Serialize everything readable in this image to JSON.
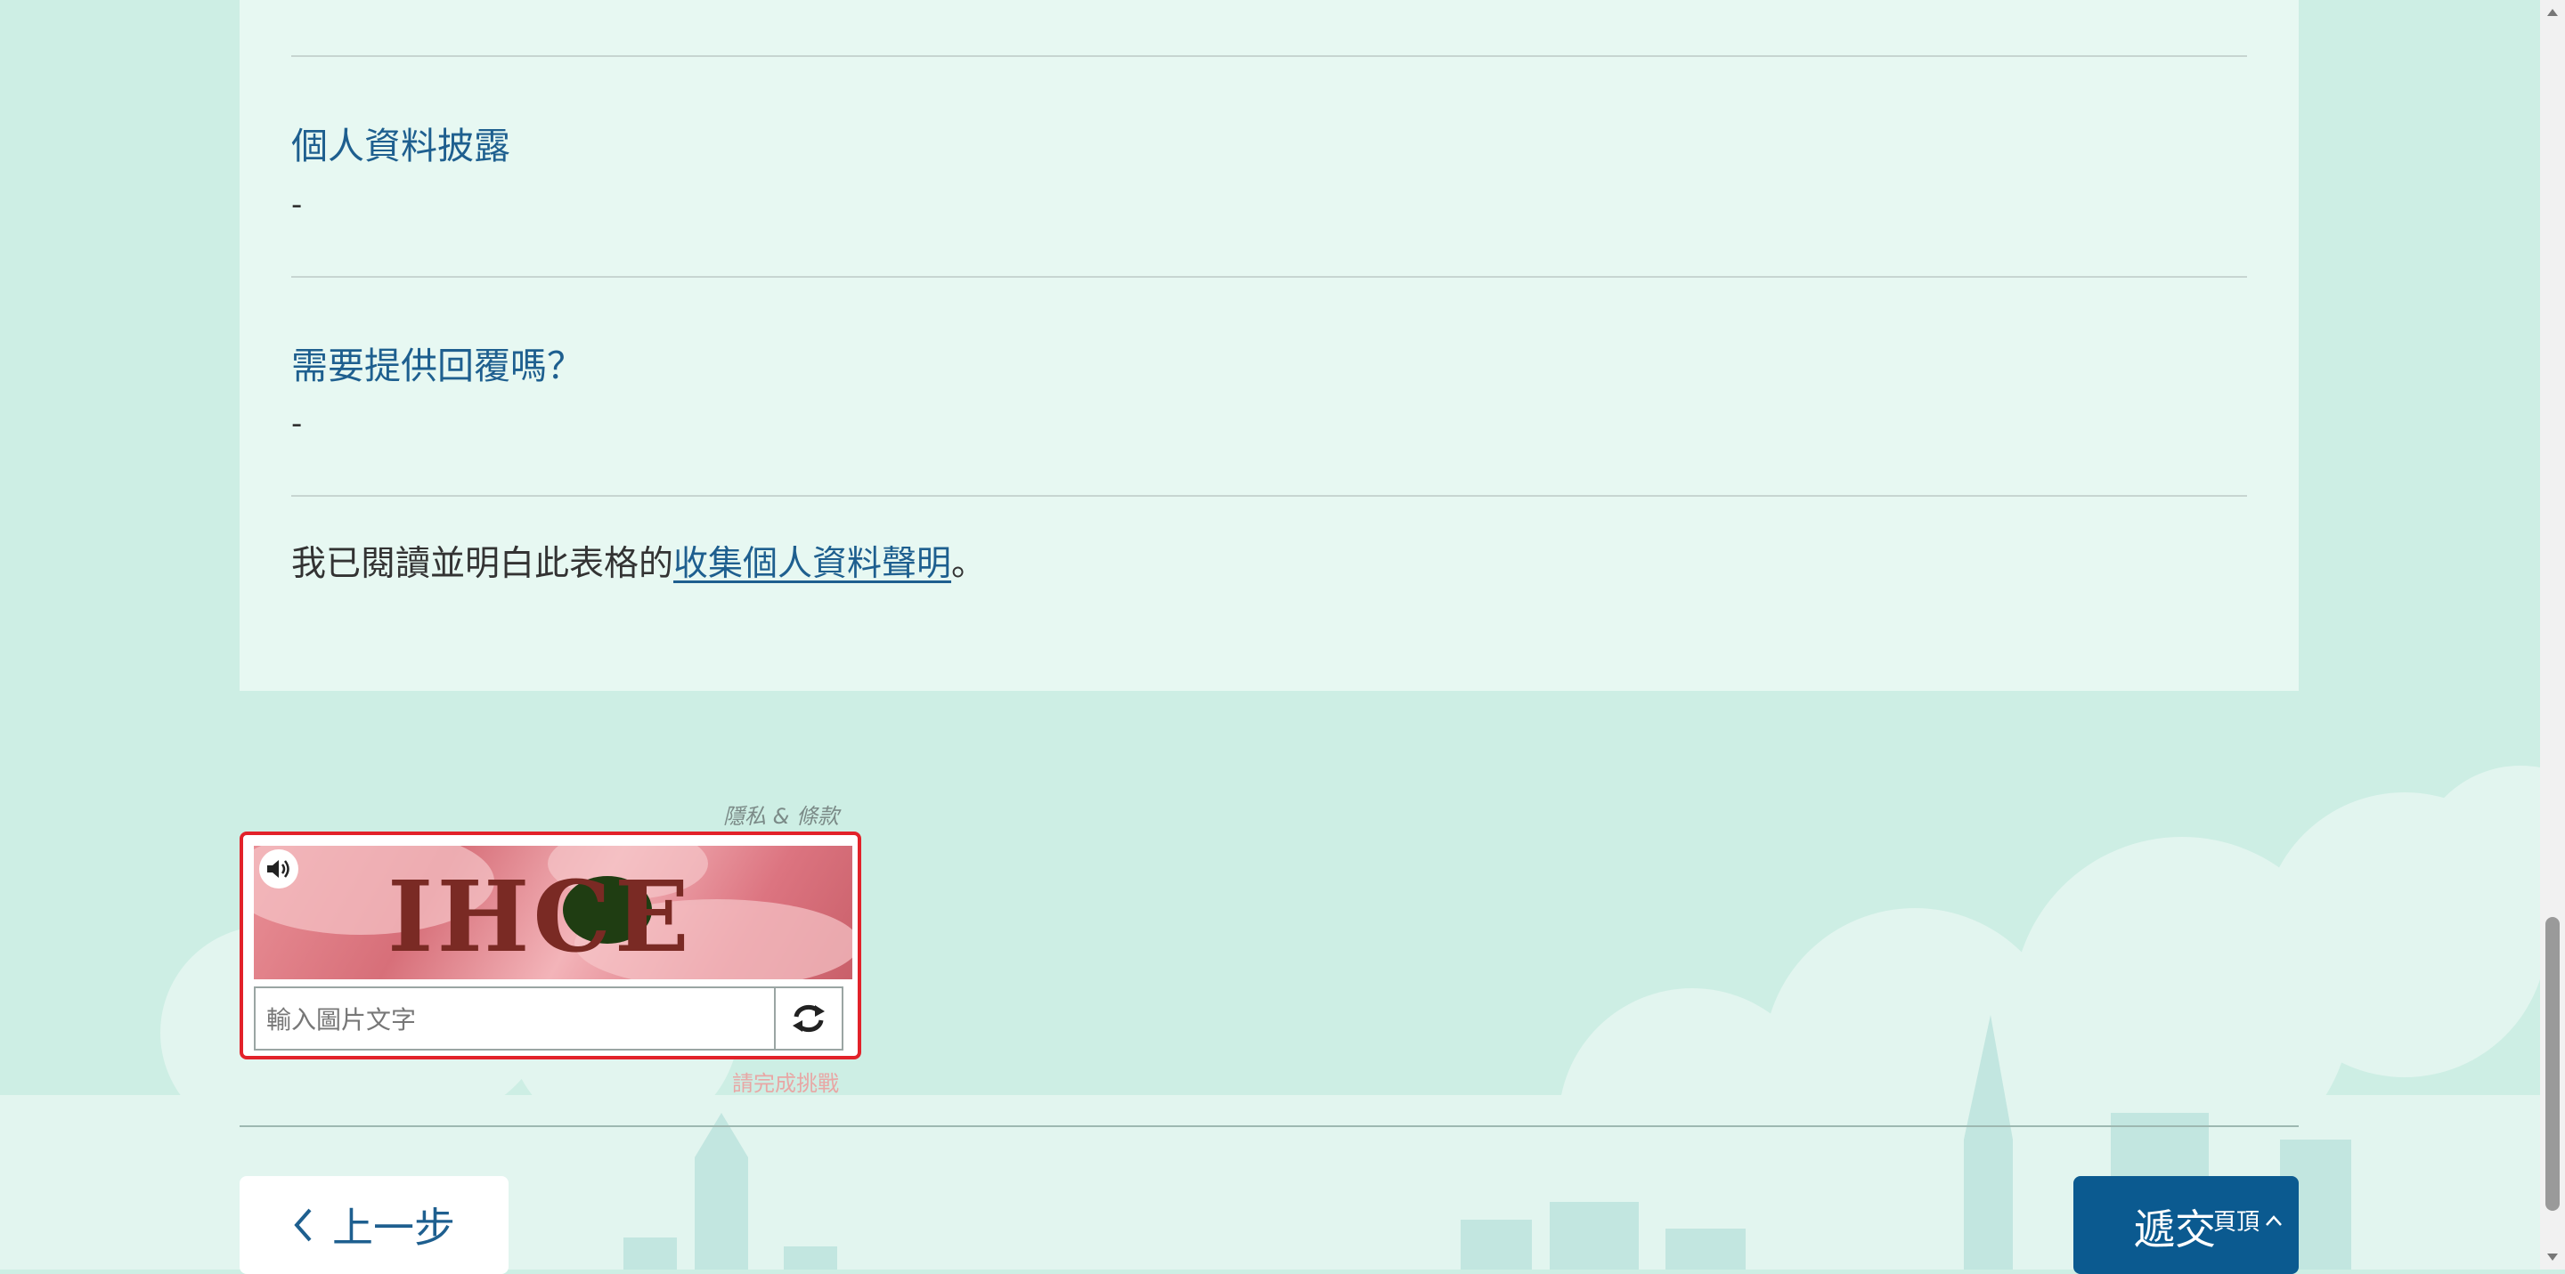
{
  "form": {
    "section1": {
      "title": "個人資料披露",
      "value": "-"
    },
    "section2": {
      "title": "需要提供回覆嗎？",
      "value": "-"
    },
    "declaration": {
      "prefix": "我已閱讀並明白此表格的",
      "link": "收集個人資料聲明",
      "suffix": "。"
    }
  },
  "captcha": {
    "privacy_link": "隱私 & 條款",
    "image_text": "IHCE",
    "input_placeholder": "輸入圖片文字",
    "error": "請完成挑戰",
    "audio_icon": "speaker-icon",
    "refresh_icon": "refresh-icon"
  },
  "nav": {
    "prev_label": "上一步",
    "submit_label": "遞交",
    "top_label": "頁頂"
  },
  "colors": {
    "accent": "#1e5f8f",
    "submit_bg": "#0b5a90",
    "captcha_border": "#e2222a",
    "page_bg": "#cdeee4",
    "card_bg": "#e7f8f2"
  }
}
